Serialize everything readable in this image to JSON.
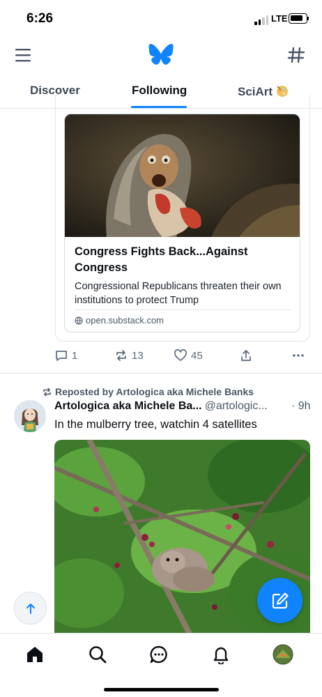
{
  "status": {
    "time": "6:26",
    "network": "LTE"
  },
  "tabs": [
    {
      "label": "Discover",
      "active": false
    },
    {
      "label": "Following",
      "active": true
    },
    {
      "label": "SciArt",
      "active": false,
      "icon": "sciart-feed-icon"
    }
  ],
  "post1": {
    "embed": {
      "title": "Congress Fights Back...Against Congress",
      "description": "Congressional Republicans threaten their own institutions to protect Trump",
      "domain": "open.substack.com"
    },
    "actions": {
      "replies": "1",
      "reposts": "13",
      "likes": "45"
    }
  },
  "post2": {
    "reposted_by": "Reposted by Artologica aka Michele Banks",
    "author_name": "Artologica aka Michele Ba...",
    "author_handle": "@artologic...",
    "time": "· 9h",
    "text": "In the mulberry tree, watchin 4 satellites"
  },
  "colors": {
    "accent": "#1083fe",
    "muted": "#5b6a7c",
    "border": "#e2e6ea"
  }
}
